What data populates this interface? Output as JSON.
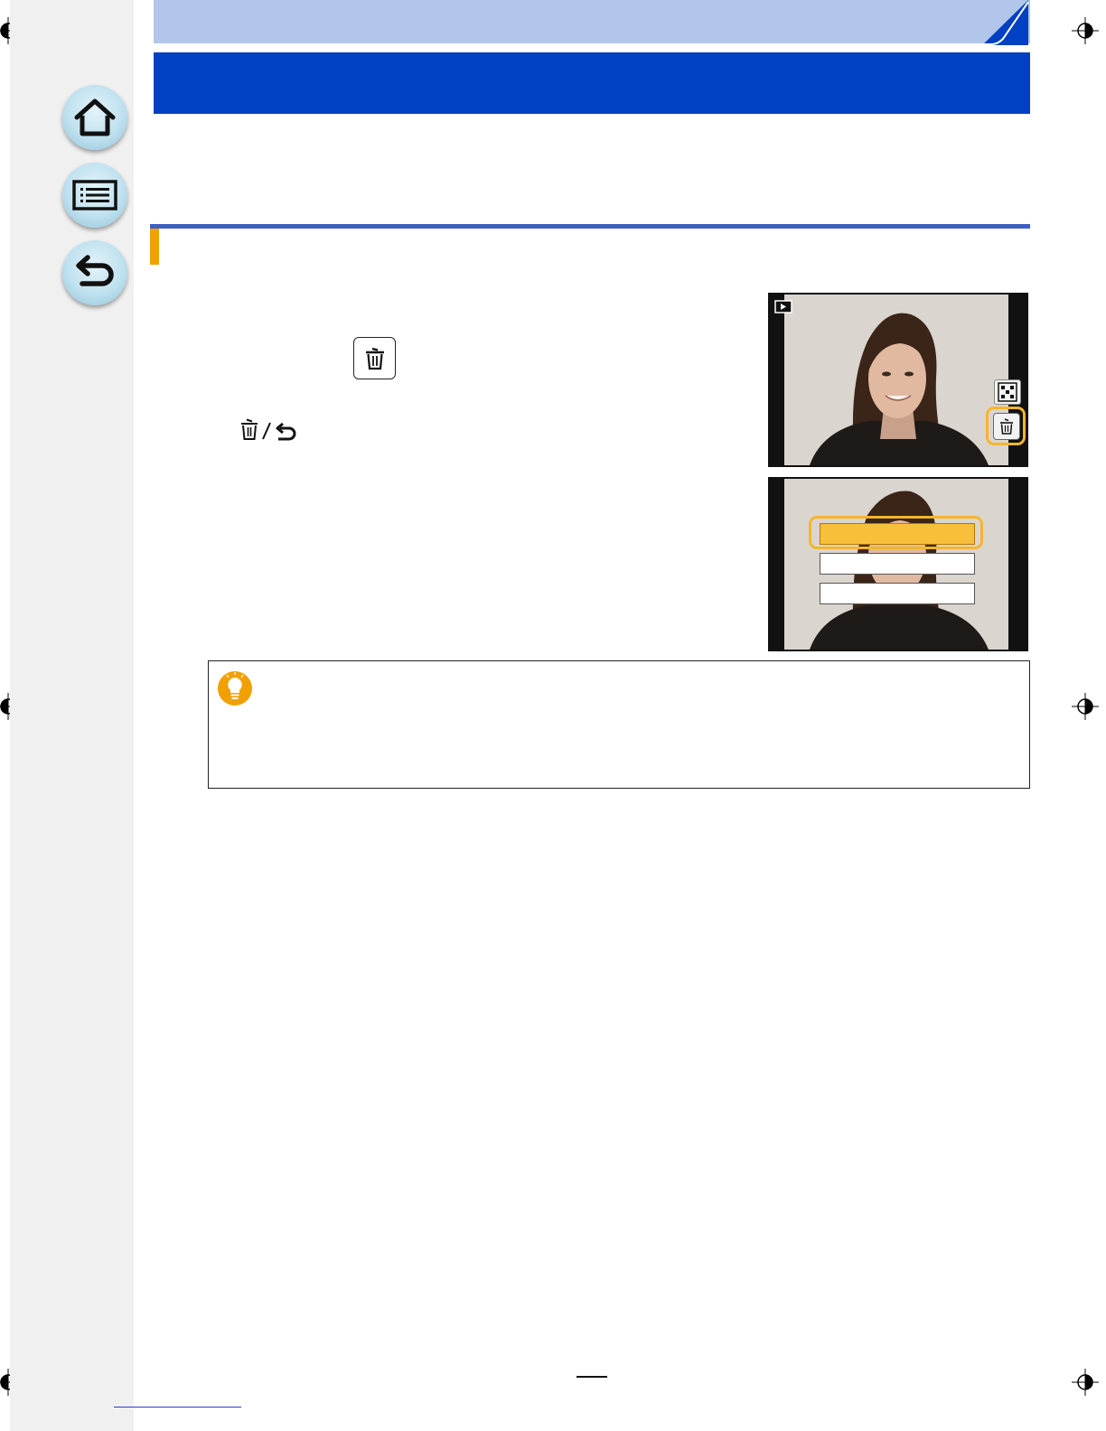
{
  "navigation": {
    "home": {
      "icon": "home-icon"
    },
    "menu": {
      "icon": "list-icon"
    },
    "back": {
      "icon": "return-icon"
    }
  },
  "body": {
    "inline_button_icons": [
      "trash-icon",
      "return-icon"
    ],
    "touch_button_icon": "trash-icon"
  },
  "screens": {
    "playback": {
      "icons": [
        "playback-mode-icon",
        "multi-playback-icon",
        "delete-touch-icon"
      ]
    },
    "delete_menu": {
      "options_count": 3,
      "selected_index": 0
    }
  },
  "hint": {
    "icon": "lightbulb-icon"
  },
  "colors": {
    "header_light": "#b2c6ec",
    "header_dark": "#0040c2",
    "accent": "#f0a000",
    "highlight": "#f7bf3a"
  }
}
